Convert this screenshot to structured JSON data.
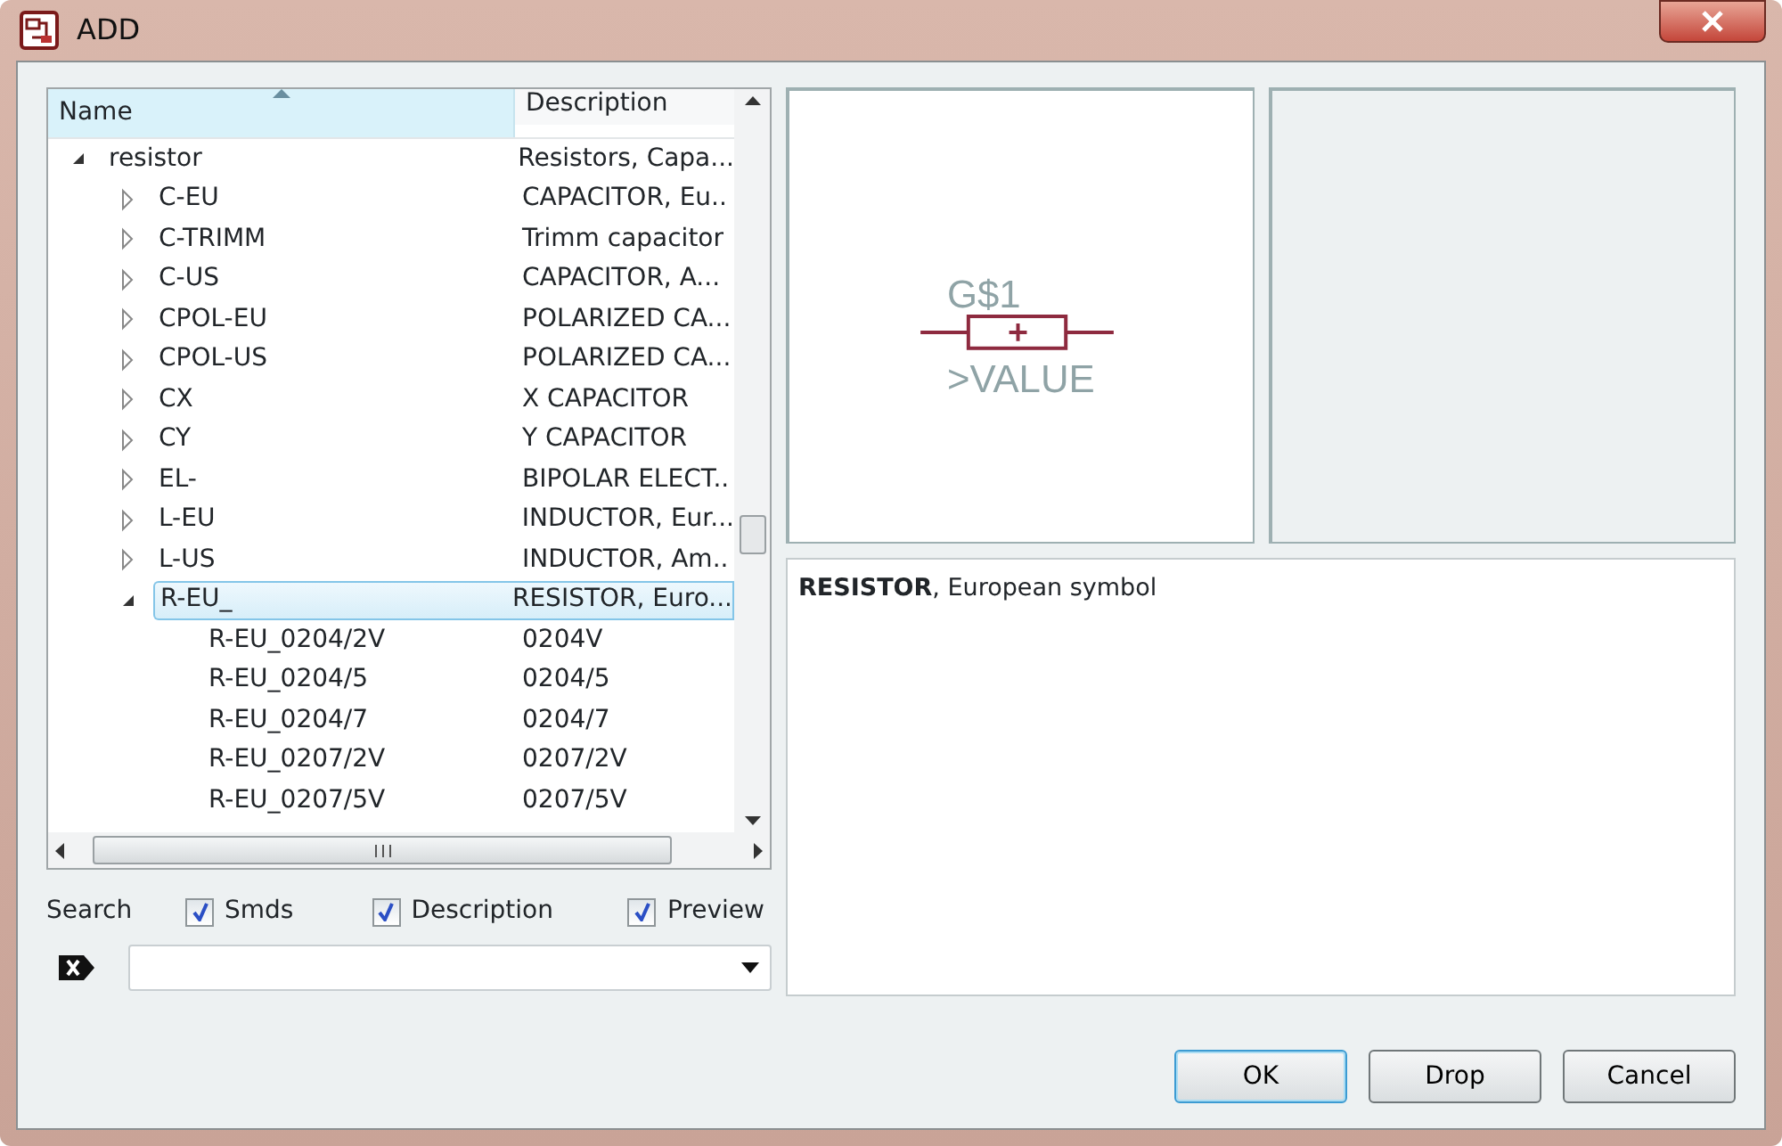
{
  "window": {
    "title": "ADD"
  },
  "tree": {
    "columns": [
      "Name",
      "Description"
    ],
    "items": [
      {
        "name": "resistor",
        "description": "Resistors, Capa...",
        "expanded": true,
        "selected": false,
        "children": [
          {
            "name": "C-EU",
            "description": "CAPACITOR, Eu..",
            "expanded": false,
            "selected": false
          },
          {
            "name": "C-TRIMM",
            "description": "Trimm capacitor",
            "expanded": false,
            "selected": false
          },
          {
            "name": "C-US",
            "description": "CAPACITOR, A...",
            "expanded": false,
            "selected": false
          },
          {
            "name": "CPOL-EU",
            "description": "POLARIZED CA...",
            "expanded": false,
            "selected": false
          },
          {
            "name": "CPOL-US",
            "description": "POLARIZED CA...",
            "expanded": false,
            "selected": false
          },
          {
            "name": "CX",
            "description": "X CAPACITOR",
            "expanded": false,
            "selected": false
          },
          {
            "name": "CY",
            "description": "Y CAPACITOR",
            "expanded": false,
            "selected": false
          },
          {
            "name": "EL-",
            "description": "BIPOLAR ELECT..",
            "expanded": false,
            "selected": false
          },
          {
            "name": "L-EU",
            "description": "INDUCTOR, Eur...",
            "expanded": false,
            "selected": false
          },
          {
            "name": "L-US",
            "description": "INDUCTOR, Am..",
            "expanded": false,
            "selected": false
          },
          {
            "name": "R-EU_",
            "description": "RESISTOR, Euro...",
            "expanded": true,
            "selected": true,
            "children": [
              {
                "name": "R-EU_0204/2V",
                "description": "0204V",
                "selected": false
              },
              {
                "name": "R-EU_0204/5",
                "description": "0204/5",
                "selected": false
              },
              {
                "name": "R-EU_0204/7",
                "description": "0204/7",
                "selected": false
              },
              {
                "name": "R-EU_0207/2V",
                "description": "0207/2V",
                "selected": false
              },
              {
                "name": "R-EU_0207/5V",
                "description": "0207/5V",
                "selected": false
              }
            ]
          }
        ]
      }
    ]
  },
  "search": {
    "label": "Search",
    "options": [
      {
        "label": "Smds",
        "checked": true
      },
      {
        "label": "Description",
        "checked": true
      },
      {
        "label": "Preview",
        "checked": true
      }
    ]
  },
  "preview": {
    "name_label": "G$1",
    "value_label": ">VALUE"
  },
  "description": "**RESISTOR**, European symbol",
  "buttons": [
    {
      "label": "OK",
      "default": true
    },
    {
      "label": "Drop",
      "default": false
    },
    {
      "label": "Cancel",
      "default": false
    }
  ]
}
